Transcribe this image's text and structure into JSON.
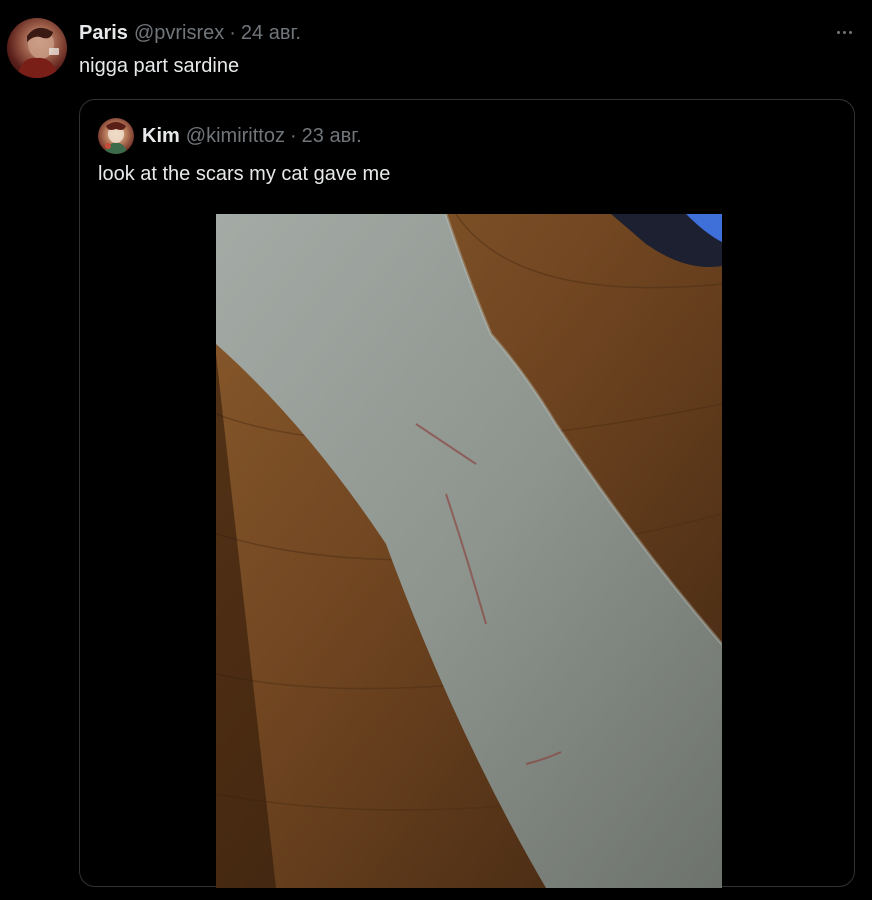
{
  "tweet": {
    "author_name": "Paris",
    "author_handle": "@pvrisrex",
    "separator": "·",
    "date": "24 авг.",
    "text": "nigga part sardine",
    "more_icon": "more-horizontal-icon"
  },
  "quoted_tweet": {
    "author_name": "Kim",
    "author_handle": "@kimirittoz",
    "separator": "·",
    "date": "23 авг.",
    "text": "look at the scars my cat gave me"
  },
  "colors": {
    "background": "#000000",
    "primary_text": "#e7e9ea",
    "secondary_text": "#71767b",
    "border": "#2f3336"
  }
}
